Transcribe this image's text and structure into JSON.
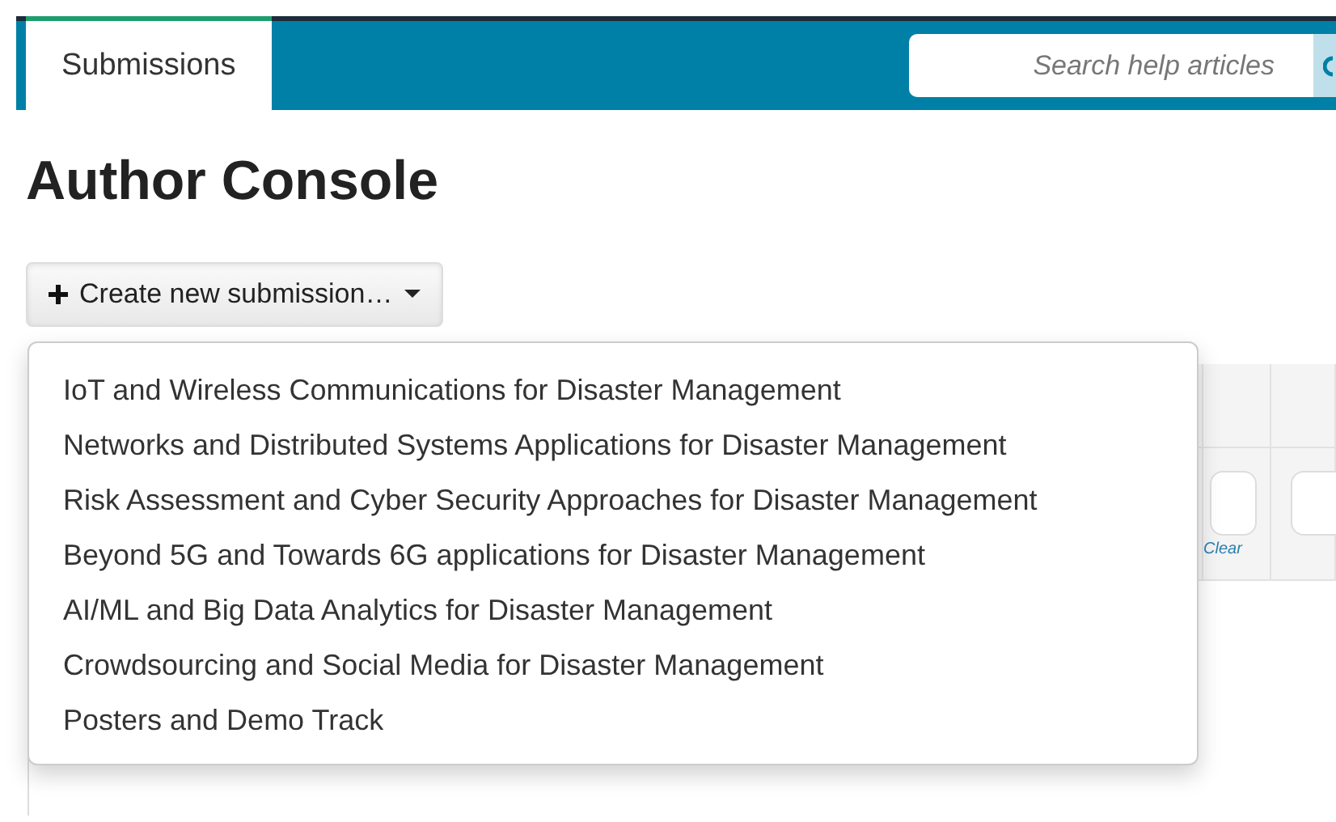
{
  "tabs": [
    {
      "label": "Submissions",
      "selected": true
    }
  ],
  "search": {
    "placeholder": "Search help articles"
  },
  "heading": "Author Console",
  "create_button": {
    "label": "Create new submission…",
    "expanded": true
  },
  "menu_items": [
    {
      "label": "IoT and Wireless Communications for Disaster Management"
    },
    {
      "label": "Networks and Distributed Systems Applications for Disaster Management"
    },
    {
      "label": "Risk Assessment and Cyber Security Approaches for Disaster Management"
    },
    {
      "label": "Beyond 5G and Towards 6G applications for Disaster Management"
    },
    {
      "label": "AI/ML and Big Data Analytics for Disaster Management"
    },
    {
      "label": "Crowdsourcing and Social Media for Disaster Management"
    },
    {
      "label": "Posters and Demo Track"
    }
  ],
  "table_filter": {
    "clear_link": "Clear"
  }
}
